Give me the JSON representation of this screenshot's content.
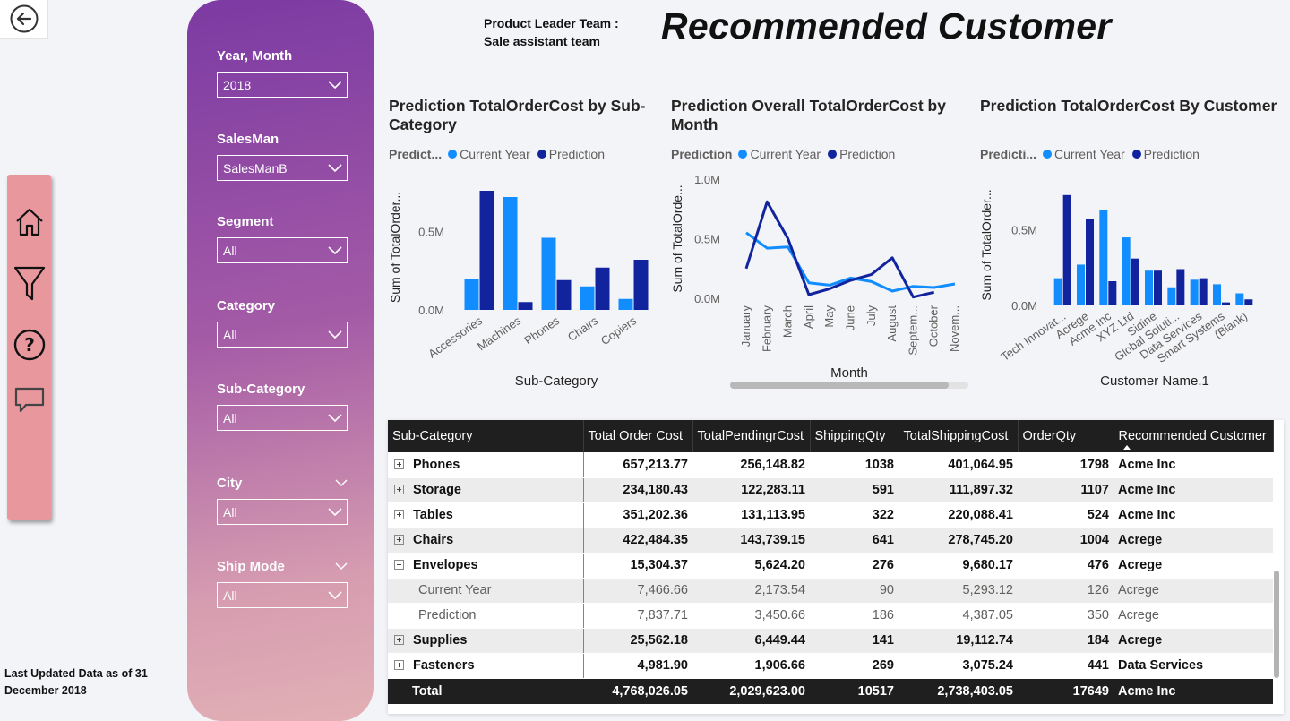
{
  "header": {
    "team_line1": "Product Leader Team :",
    "team_line2": "Sale assistant team",
    "title": "Recommended Customer"
  },
  "footer": {
    "updated_line1": "Last Updated Data as of 31",
    "updated_line2": "December 2018"
  },
  "nav": {
    "icons": [
      "home-icon",
      "filter-icon",
      "help-icon",
      "chat-icon"
    ]
  },
  "slicers": [
    {
      "label": "Year, Month",
      "value": "2018",
      "collapsible": false
    },
    {
      "label": "SalesMan",
      "value": "SalesManB",
      "collapsible": false
    },
    {
      "label": "Segment",
      "value": "All",
      "collapsible": false
    },
    {
      "label": "Category",
      "value": "All",
      "collapsible": false
    },
    {
      "label": "Sub-Category",
      "value": "All",
      "collapsible": false
    },
    {
      "label": "City",
      "value": "All",
      "collapsible": true
    },
    {
      "label": "Ship Mode",
      "value": "All",
      "collapsible": true
    }
  ],
  "colors": {
    "current_year": "#118dff",
    "prediction": "#12239e"
  },
  "charts": {
    "sub_category": {
      "legend_title": "Predict...",
      "legend": [
        "Current Year",
        "Prediction"
      ],
      "ylabel": "Sum of TotalOrder...",
      "xlabel": "Sub-Category"
    },
    "month": {
      "legend_title": "Prediction",
      "legend": [
        "Current Year",
        "Prediction"
      ],
      "ylabel": "Sum of TotalOrde...",
      "xlabel": "Month"
    },
    "customer": {
      "legend_title": "Predicti...",
      "legend": [
        "Current Year",
        "Prediction"
      ],
      "ylabel": "Sum of TotalOrder...",
      "xlabel": "Customer Name.1"
    }
  },
  "chart_data": [
    {
      "type": "bar",
      "title": "Prediction TotalOrderCost by Sub-Category",
      "xlabel": "Sub-Category",
      "ylabel": "Sum of TotalOrder...",
      "categories": [
        "Accessories",
        "Machines",
        "Phones",
        "Chairs",
        "Copiers"
      ],
      "series": [
        {
          "name": "Current Year",
          "values": [
            0.2,
            0.72,
            0.46,
            0.15,
            0.07
          ]
        },
        {
          "name": "Prediction",
          "values": [
            0.76,
            0.05,
            0.19,
            0.27,
            0.32
          ]
        }
      ],
      "yticks": [
        "0.0M",
        "0.5M"
      ],
      "ylim": [
        0,
        0.8
      ],
      "unit": "M"
    },
    {
      "type": "line",
      "title": "Prediction Overall TotalOrderCost by Month",
      "xlabel": "Month",
      "ylabel": "Sum of TotalOrde...",
      "categories": [
        "January",
        "February",
        "March",
        "April",
        "May",
        "June",
        "July",
        "August",
        "Septem...",
        "October",
        "Novem..."
      ],
      "series": [
        {
          "name": "Current Year",
          "values": [
            0.55,
            0.42,
            0.43,
            0.13,
            0.11,
            0.17,
            0.14,
            0.06,
            0.1,
            0.09,
            0.12
          ]
        },
        {
          "name": "Prediction",
          "values": [
            0.25,
            0.81,
            0.5,
            0.03,
            0.08,
            0.15,
            0.2,
            0.34,
            0.01,
            0.05,
            null
          ]
        }
      ],
      "yticks": [
        "0.0M",
        "0.5M",
        "1.0M"
      ],
      "ylim": [
        0,
        1.0
      ],
      "unit": "M"
    },
    {
      "type": "bar",
      "title": "Prediction TotalOrderCost By Customer",
      "xlabel": "Customer Name.1",
      "ylabel": "Sum of TotalOrder...",
      "categories": [
        "Tech Innovat...",
        "Acrege",
        "Acme Inc",
        "XYZ Ltd",
        "Sidine",
        "Global Soluti...",
        "Data Services",
        "Smart Systems",
        "(Blank)"
      ],
      "series": [
        {
          "name": "Current Year",
          "values": [
            0.18,
            0.27,
            0.63,
            0.45,
            0.23,
            0.12,
            0.17,
            0.14,
            0.08
          ]
        },
        {
          "name": "Prediction",
          "values": [
            0.73,
            0.57,
            0.16,
            0.31,
            0.23,
            0.24,
            0.18,
            0.02,
            0.04
          ]
        }
      ],
      "yticks": [
        "0.0M",
        "0.5M"
      ],
      "ylim": [
        0,
        0.8
      ],
      "unit": "M"
    }
  ],
  "table": {
    "columns": [
      "Sub-Category",
      "Total Order Cost",
      "TotalPendingrCost",
      "ShippingQty",
      "TotalShippingCost",
      "OrderQty",
      "Recommended Customer"
    ],
    "rows": [
      {
        "kind": "parent",
        "expanded": false,
        "cells": [
          "Phones",
          "657,213.77",
          "256,148.82",
          "1038",
          "401,064.95",
          "1798",
          "Acme Inc"
        ]
      },
      {
        "kind": "parent",
        "expanded": false,
        "cells": [
          "Storage",
          "234,180.43",
          "122,283.11",
          "591",
          "111,897.32",
          "1107",
          "Acme Inc"
        ]
      },
      {
        "kind": "parent",
        "expanded": false,
        "cells": [
          "Tables",
          "351,202.36",
          "131,113.95",
          "322",
          "220,088.41",
          "524",
          "Acme Inc"
        ]
      },
      {
        "kind": "parent",
        "expanded": false,
        "cells": [
          "Chairs",
          "422,484.35",
          "143,739.15",
          "641",
          "278,745.20",
          "1004",
          "Acrege"
        ]
      },
      {
        "kind": "parent",
        "expanded": true,
        "cells": [
          "Envelopes",
          "15,304.37",
          "5,624.20",
          "276",
          "9,680.17",
          "476",
          "Acrege"
        ]
      },
      {
        "kind": "child",
        "cells": [
          "Current Year",
          "7,466.66",
          "2,173.54",
          "90",
          "5,293.12",
          "126",
          "Acrege"
        ]
      },
      {
        "kind": "child",
        "cells": [
          "Prediction",
          "7,837.71",
          "3,450.66",
          "186",
          "4,387.05",
          "350",
          "Acrege"
        ]
      },
      {
        "kind": "parent",
        "expanded": false,
        "cells": [
          "Supplies",
          "25,562.18",
          "6,449.44",
          "141",
          "19,112.74",
          "184",
          "Acrege"
        ]
      },
      {
        "kind": "parent",
        "expanded": false,
        "cells": [
          "Fasteners",
          "4,981.90",
          "1,906.66",
          "269",
          "3,075.24",
          "441",
          "Data Services"
        ]
      }
    ],
    "total": [
      "Total",
      "4,768,026.05",
      "2,029,623.00",
      "10517",
      "2,738,403.05",
      "17649",
      "Acme Inc"
    ]
  }
}
